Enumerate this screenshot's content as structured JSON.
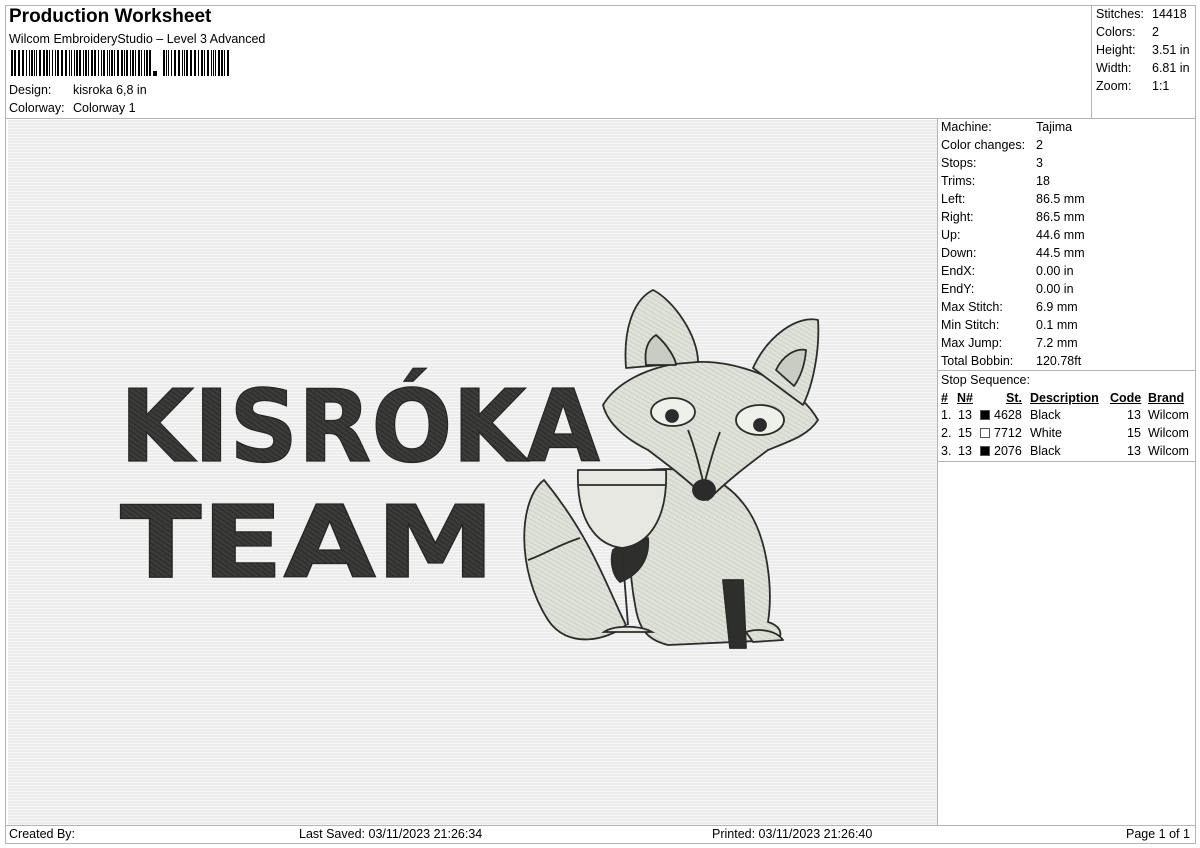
{
  "header": {
    "title": "Production Worksheet",
    "subtitle": "Wilcom EmbroideryStudio – Level 3 Advanced",
    "design_label": "Design:",
    "design_value": "kisroka 6,8 in",
    "colorway_label": "Colorway:",
    "colorway_value": "Colorway 1"
  },
  "stats": [
    {
      "label": "Stitches:",
      "value": "14418"
    },
    {
      "label": "Colors:",
      "value": "2"
    },
    {
      "label": "Height:",
      "value": "3.51 in"
    },
    {
      "label": "Width:",
      "value": "6.81 in"
    },
    {
      "label": "Zoom:",
      "value": "1:1"
    }
  ],
  "design": {
    "line1": "KISRÓKA",
    "line2": "TEAM",
    "thread_colors": {
      "black": "#3a3b38",
      "light": "#dcdfd6",
      "outline": "#2b2b2b"
    }
  },
  "machine_info": [
    {
      "label": "Machine:",
      "value": "Tajima"
    },
    {
      "label": "Color changes:",
      "value": "2"
    },
    {
      "label": "Stops:",
      "value": "3"
    },
    {
      "label": "Trims:",
      "value": "18"
    },
    {
      "label": "Left:",
      "value": "86.5 mm"
    },
    {
      "label": "Right:",
      "value": "86.5 mm"
    },
    {
      "label": "Up:",
      "value": "44.6 mm"
    },
    {
      "label": "Down:",
      "value": "44.5 mm"
    },
    {
      "label": "EndX:",
      "value": "0.00 in"
    },
    {
      "label": "EndY:",
      "value": "0.00 in"
    },
    {
      "label": "Max Stitch:",
      "value": "6.9 mm"
    },
    {
      "label": "Min Stitch:",
      "value": "0.1 mm"
    },
    {
      "label": "Max Jump:",
      "value": "7.2 mm"
    },
    {
      "label": "Total Bobbin:",
      "value": "120.78ft"
    }
  ],
  "stop_sequence": {
    "title": "Stop Sequence:",
    "headers": {
      "num": "#",
      "n": "N#",
      "st": "St.",
      "description": "Description",
      "code": "Code",
      "brand": "Brand"
    },
    "rows": [
      {
        "index": "1.",
        "n": "13",
        "swatch": "#000000",
        "st": "4628",
        "description": "Black",
        "code": "13",
        "brand": "Wilcom"
      },
      {
        "index": "2.",
        "n": "15",
        "swatch": "#ffffff",
        "st": "7712",
        "description": "White",
        "code": "15",
        "brand": "Wilcom"
      },
      {
        "index": "3.",
        "n": "13",
        "swatch": "#000000",
        "st": "2076",
        "description": "Black",
        "code": "13",
        "brand": "Wilcom"
      }
    ]
  },
  "footer": {
    "created_by": "Created By:",
    "last_saved": "Last Saved: 03/11/2023 21:26:34",
    "printed": "Printed: 03/11/2023 21:26:40",
    "page": "Page 1 of 1"
  }
}
